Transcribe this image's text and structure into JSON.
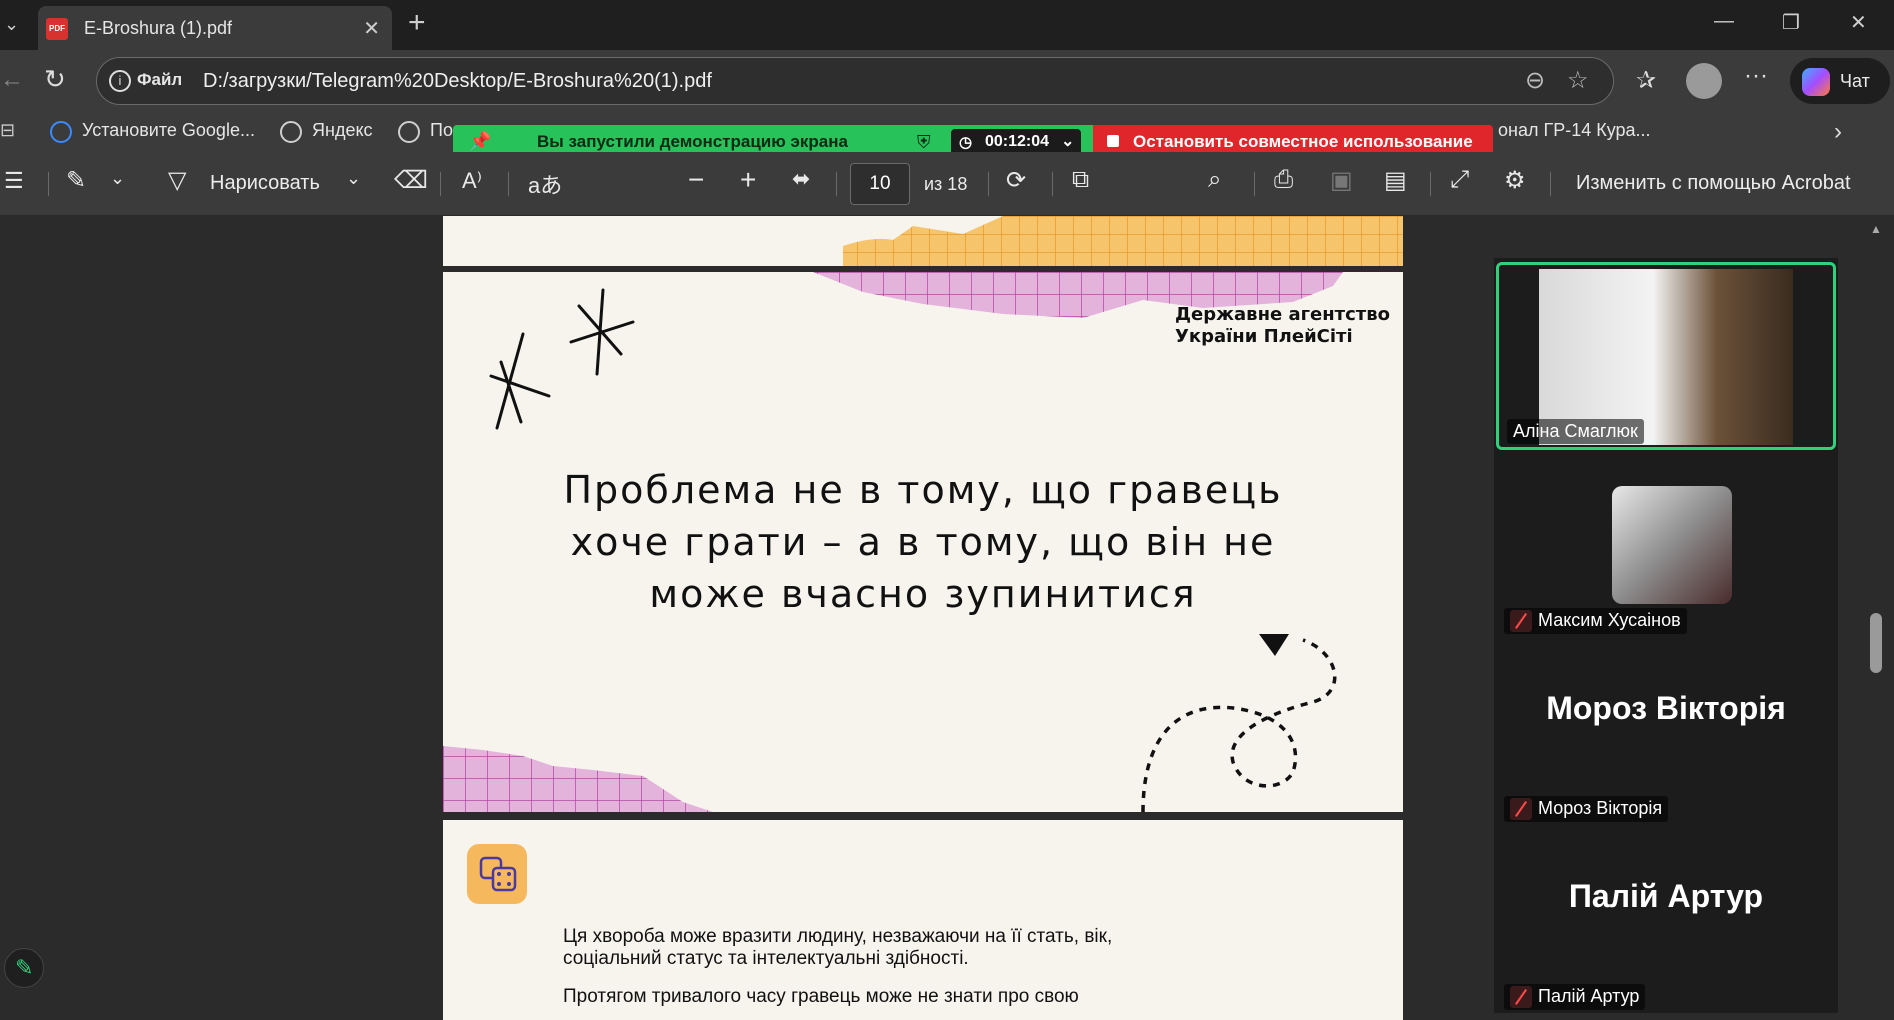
{
  "tab": {
    "title": "E-Broshura (1).pdf",
    "badge": "PDF"
  },
  "address": {
    "file_label": "Файл",
    "url": "D:/загрузки/Telegram%20Desktop/E-Broshura%20(1).pdf"
  },
  "copilot": {
    "label": "Чат"
  },
  "bookmarks": [
    {
      "label": "Установите Google..."
    },
    {
      "label": "Яндекс"
    },
    {
      "label": "По"
    },
    {
      "label": "онал ГР-14 Кура..."
    }
  ],
  "share_banner": {
    "message": "Вы запустили демонстрацию экрана",
    "timer": "00:12:04",
    "stop_label": "Остановить совместное использование"
  },
  "pdf_toolbar": {
    "draw_label": "Нарисовать",
    "page_current": "10",
    "page_total": "из 18",
    "acrobat_label": "Изменить с помощью Acrobat"
  },
  "document": {
    "agency_line1": "Державне агентство",
    "agency_line2": "України ПлейСіті",
    "quote_line1": "Проблема не в тому, що гравець",
    "quote_line2": "хоче грати – а в тому, що він не",
    "quote_line3": "може вчасно зупинитися",
    "body_line1": "Ця хвороба може вразити людину, незважаючи на її стать, вік,",
    "body_line2": "соціальний статус та інтелектуальні здібності.",
    "body_line3": "Протягом тривалого часу гравець може не знати про свою"
  },
  "participants": [
    {
      "name": "Аліна Смаглюк"
    },
    {
      "name": "Максим Хусаінов"
    },
    {
      "name": "Мороз Вікторія",
      "display": "Мороз Вікторія"
    },
    {
      "name": "Палій Артур",
      "display": "Палій Артур"
    }
  ],
  "colors": {
    "share_green": "#27c25a",
    "share_red": "#e0262b",
    "active_speaker": "#2fd17b",
    "grid_orange": "#f6c46a",
    "grid_pink": "#e3b3dc"
  }
}
